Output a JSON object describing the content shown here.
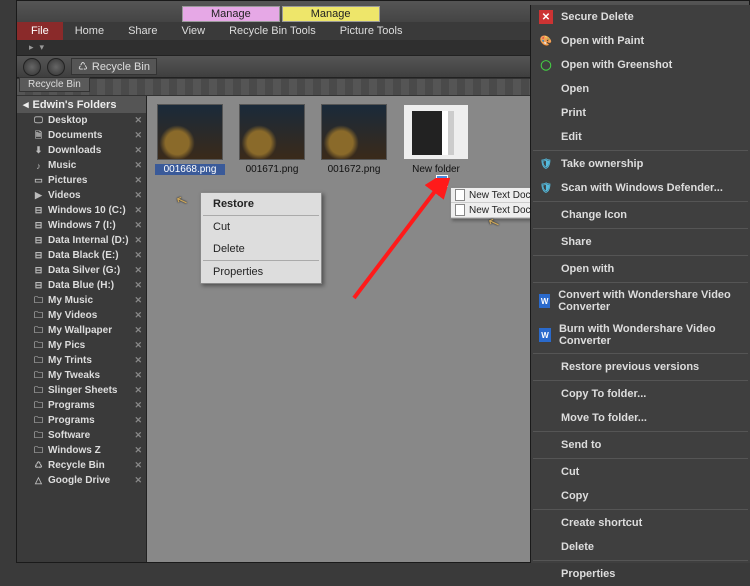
{
  "titlebar": {
    "manage1": "Manage",
    "manage2": "Manage"
  },
  "menu": {
    "file": "File",
    "home": "Home",
    "share": "Share",
    "view": "View",
    "rbtools": "Recycle Bin Tools",
    "pictools": "Picture Tools"
  },
  "address": {
    "location": "Recycle Bin",
    "tab": "Recycle Bin"
  },
  "sidebar": {
    "header": "Edwin's Folders",
    "items": [
      {
        "label": "Desktop",
        "icon": "🖵"
      },
      {
        "label": "Documents",
        "icon": "🗎"
      },
      {
        "label": "Downloads",
        "icon": "⬇"
      },
      {
        "label": "Music",
        "icon": "♪"
      },
      {
        "label": "Pictures",
        "icon": "▭"
      },
      {
        "label": "Videos",
        "icon": "▶"
      },
      {
        "label": "Windows 10 (C:)",
        "icon": "⊟"
      },
      {
        "label": "Windows 7 (I:)",
        "icon": "⊟"
      },
      {
        "label": "Data Internal (D:)",
        "icon": "⊟"
      },
      {
        "label": "Data Black (E:)",
        "icon": "⊟"
      },
      {
        "label": "Data Silver (G:)",
        "icon": "⊟"
      },
      {
        "label": "Data Blue (H:)",
        "icon": "⊟"
      },
      {
        "label": "My Music",
        "icon": "🗀"
      },
      {
        "label": "My Videos",
        "icon": "🗀"
      },
      {
        "label": "My Wallpaper",
        "icon": "🗀"
      },
      {
        "label": "My Pics",
        "icon": "🗀"
      },
      {
        "label": "My Trints",
        "icon": "🗀"
      },
      {
        "label": "My Tweaks",
        "icon": "🗀"
      },
      {
        "label": "Slinger Sheets",
        "icon": "🗀"
      },
      {
        "label": "Programs",
        "icon": "🗀"
      },
      {
        "label": "Programs",
        "icon": "🗀"
      },
      {
        "label": "Software",
        "icon": "🗀"
      },
      {
        "label": "Windows Z",
        "icon": "🗀"
      },
      {
        "label": "Recycle Bin",
        "icon": "♺"
      },
      {
        "label": "Google Drive",
        "icon": "△"
      }
    ]
  },
  "files": [
    {
      "label": "001668.png",
      "cls": "img1",
      "sel": true
    },
    {
      "label": "001671.png",
      "cls": "img2",
      "sel": false
    },
    {
      "label": "001672.png",
      "cls": "img3",
      "sel": false
    },
    {
      "label": "New folder",
      "cls": "folder",
      "sel": false
    }
  ],
  "ctx_small": {
    "restore": "Restore",
    "cut": "Cut",
    "delete": "Delete",
    "properties": "Properties"
  },
  "doclist": {
    "doc1": "New Text Docu",
    "doc2": "New Text Docu"
  },
  "ctx_large": [
    {
      "label": "Secure Delete",
      "icon": "✕",
      "iconcls": "ic-red"
    },
    {
      "label": "Open with Paint",
      "icon": "🎨",
      "iconcls": "ic-blue"
    },
    {
      "label": "Open with Greenshot",
      "icon": "◯",
      "iconcls": "ic-green"
    },
    {
      "label": "Open",
      "sep_before": false
    },
    {
      "label": "Print"
    },
    {
      "label": "Edit"
    },
    {
      "sep": true
    },
    {
      "label": "Take ownership",
      "icon": "🛡",
      "iconcls": "ic-shield"
    },
    {
      "label": "Scan with Windows Defender...",
      "icon": "🛡",
      "iconcls": "ic-shield"
    },
    {
      "sep": true
    },
    {
      "label": "Change Icon"
    },
    {
      "sep": true
    },
    {
      "label": "Share"
    },
    {
      "sep": true
    },
    {
      "label": "Open with"
    },
    {
      "sep": true
    },
    {
      "label": "Convert with Wondershare Video Converter",
      "icon": "W",
      "iconcls": "ic-ws"
    },
    {
      "label": "Burn with Wondershare Video Converter",
      "icon": "W",
      "iconcls": "ic-ws"
    },
    {
      "sep": true
    },
    {
      "label": "Restore previous versions"
    },
    {
      "sep": true
    },
    {
      "label": "Copy To folder..."
    },
    {
      "label": "Move To folder..."
    },
    {
      "sep": true
    },
    {
      "label": "Send to"
    },
    {
      "sep": true
    },
    {
      "label": "Cut"
    },
    {
      "label": "Copy"
    },
    {
      "sep": true
    },
    {
      "label": "Create shortcut"
    },
    {
      "label": "Delete"
    },
    {
      "sep": true
    },
    {
      "label": "Properties"
    }
  ]
}
